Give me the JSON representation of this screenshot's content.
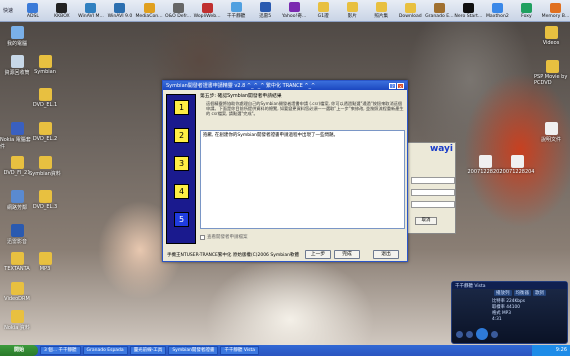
{
  "quicklaunch": {
    "title": "快速",
    "items": [
      "ADSL",
      "KKBOX",
      "WinAVI M...",
      "WinAVI 9.0",
      "MediaCon...",
      "O&O Defr...",
      "WopliWeb...",
      "千千靜聽",
      "迅雷5",
      "Yahoo!奇...",
      "G1證",
      "影片",
      "照片集",
      "Download",
      "Granado E...",
      "Nero Start...",
      "Maxthon2",
      "Foxy",
      "Memory B..."
    ]
  },
  "desktop_left": [
    "我的電腦",
    "資源回收筒",
    "Symbian",
    "DVD_EL.1",
    "Nokia 電腦套件",
    "DVD_EL.2",
    "DVD_FI_21",
    "網路芳鄰",
    "DVD_EL.3",
    "Symbian資料",
    "迅雷影音",
    "DVD_EL.3",
    "TEXTANTA",
    "MP3",
    "VideoDRM",
    "Nokia 資料"
  ],
  "desktop_right": [
    "Videos",
    "PSP Movie by PCDVD",
    "說明文件",
    "20071228202",
    "20071228204"
  ],
  "window": {
    "title": "Symbian開發者證書申請精靈 v2.8 ^_^_^ 繁中化 TRANCE ^_^",
    "steps": [
      "1",
      "2",
      "3",
      "4",
      "5"
    ],
    "heading": "第五步: 確認Symbian開發者申請結果",
    "description": "這個精靈將協助你處理自己的Symbian開發者證書申請 (.csr)檔案, 你可以透過點選\"通過\"按鈕來取消這個申請。下面是你目前所提供資料的總覽, 如要變更資料您必須一一選取\"上一步\"來修改, 並按照流程重新產生的 csr檔案, 請點選\"完成\"。",
    "result_text": "抱歉, 在創建你的Symbian開發者證書申請過程中出現了一些問題。",
    "checkbox_label": "查看開發者申請檔案",
    "credit": "手機王NTUSER-TRANCE繁中化  原始版權(C)2006 Symbian軟體",
    "back_button": "上一步",
    "finish_button": "完成",
    "cancel_button": "退出"
  },
  "mini_window": {
    "brand": "wayi",
    "cancel": "取消"
  },
  "player": {
    "title": "千千靜聽 Vista",
    "tabs": [
      "播放列",
      "均衡器",
      "歌詞"
    ],
    "info": [
      "比特率 224Kbps",
      "取樣率 44100",
      "格式 MP3"
    ],
    "time": "4:31"
  },
  "taskbar": {
    "start": "開始",
    "buttons": [
      "3 個... 千千靜聽",
      "Granado Espada",
      "靈光前線-工具",
      "Symbian開發者證書",
      "千千靜聽 Vista"
    ],
    "clock": "9:26"
  },
  "colors": {
    "titlebar": "#1c48c0",
    "step": "#ffee44",
    "step_current": "#1f3ce0",
    "taskbar": "#2a55c0"
  }
}
